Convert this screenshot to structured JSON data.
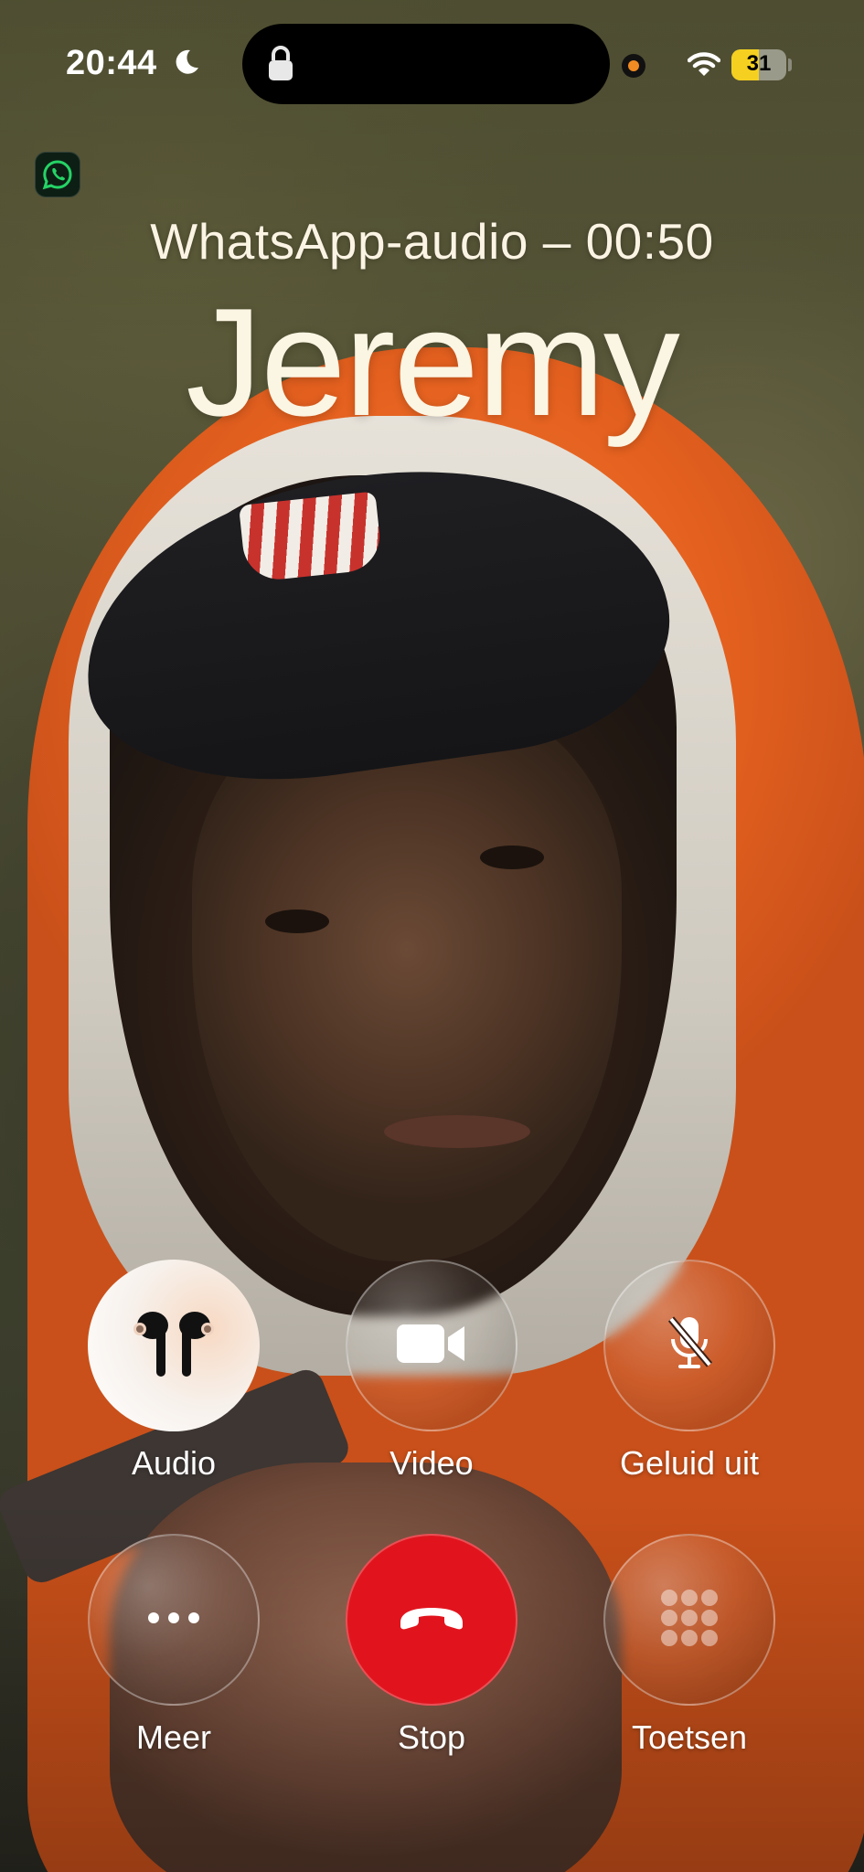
{
  "status_bar": {
    "time": "20:44",
    "battery_level": "31",
    "icons": [
      "moon-icon",
      "lock-icon",
      "recording-dot-icon",
      "wifi-icon",
      "battery-icon"
    ]
  },
  "app_badge": {
    "icon": "whatsapp-icon"
  },
  "call": {
    "status": "WhatsApp-audio – 00:50",
    "caller_name": "Jeremy"
  },
  "controls": [
    {
      "label": "Audio",
      "icon": "airpods-icon"
    },
    {
      "label": "Video",
      "icon": "video-camera-icon"
    },
    {
      "label": "Geluid uit",
      "icon": "microphone-muted-icon"
    },
    {
      "label": "Meer",
      "icon": "more-dots-icon"
    },
    {
      "label": "Stop",
      "icon": "end-call-icon",
      "color": "#e1141d"
    },
    {
      "label": "Toetsen",
      "icon": "keypad-icon"
    }
  ],
  "colors": {
    "end_call_red": "#e1141d",
    "battery_yellow": "#f5d020",
    "text_cream": "#fbf4e4"
  }
}
